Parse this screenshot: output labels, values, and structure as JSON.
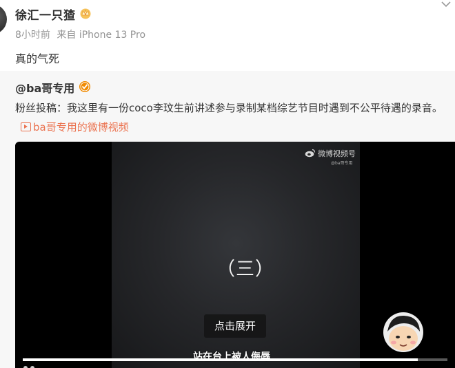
{
  "post": {
    "author": "徐汇一只猹",
    "time": "8小时前",
    "source": "来自 iPhone 13 Pro",
    "text": "真的气死"
  },
  "repost": {
    "author": "@ba哥专用",
    "text": "粉丝投稿：我这里有一份coco李玟生前讲述参与录制某档综艺节目时遇到不公平待遇的录音。",
    "video_link": "ba哥专用的微博视频"
  },
  "video": {
    "watermark": "微博视频号",
    "watermark_sub": "@ba哥专用",
    "episode_label": "（三）",
    "expand_label": "点击展开",
    "subtitle": "站在台上被人侮辱",
    "progress": 0.93
  },
  "colors": {
    "link": "#eb7350",
    "badge_verified": "#f08a00",
    "card_bg": "#f7f7f7"
  },
  "icons": [
    "crown-badge-icon",
    "verified-badge-icon",
    "chevron-down-icon",
    "video-link-icon",
    "weibo-logo-icon"
  ]
}
